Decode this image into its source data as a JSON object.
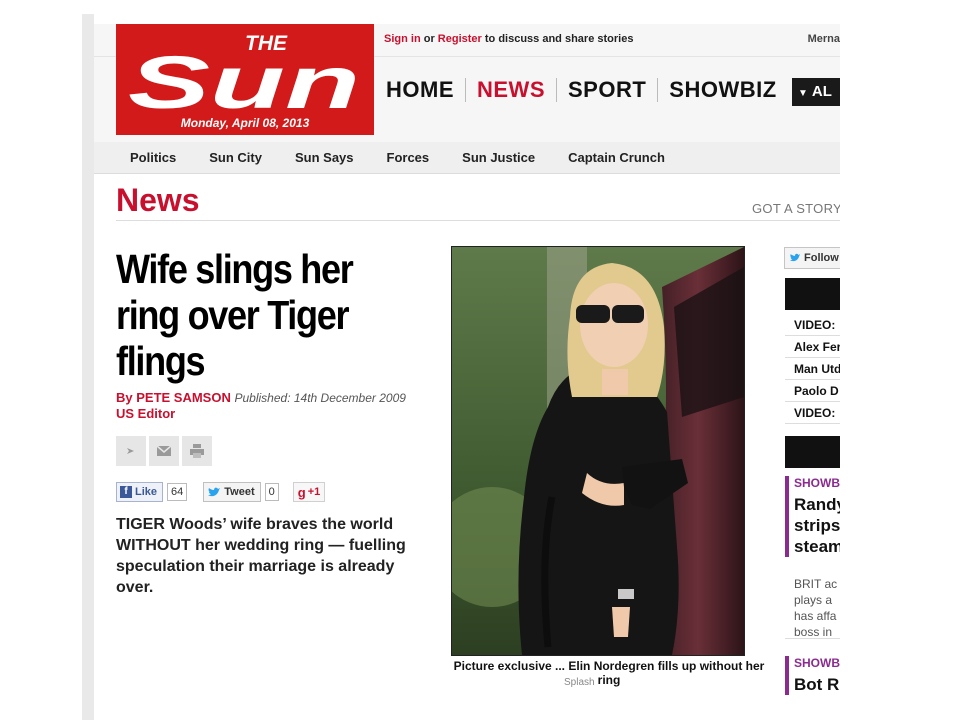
{
  "masthead": {
    "logo_text": "THE Sun",
    "logo_top": "THE",
    "logo_main": "Sun",
    "date": "Monday, April 08, 2013",
    "signin_link": "Sign in",
    "signin_or": " or ",
    "register_link": "Register",
    "signin_rest": " to discuss and share stories",
    "user_name": "Merna"
  },
  "main_nav": {
    "items": [
      {
        "label": "HOME",
        "active": false
      },
      {
        "label": "NEWS",
        "active": true
      },
      {
        "label": "SPORT",
        "active": false
      },
      {
        "label": "SHOWBIZ",
        "active": false
      }
    ],
    "all_button": "AL"
  },
  "sub_nav": {
    "items": [
      "Politics",
      "Sun City",
      "Sun Says",
      "Forces",
      "Sun Justice",
      "Captain Crunch"
    ]
  },
  "section": {
    "title": "News",
    "got_story": "GOT A STORY"
  },
  "article": {
    "headline": "Wife slings her ring over Tiger flings",
    "author": "By PETE SAMSON",
    "published": "Published: 14th December 2009",
    "role": "US Editor",
    "standfirst": "TIGER Woods’ wife braves the world WITHOUT her wedding ring — fuelling speculation their marriage is already over.",
    "photo_caption": "Picture exclusive ... Elin Nordegren fills up without her ring",
    "photo_credit": "Splash"
  },
  "social": {
    "like_label": "Like",
    "like_count": "64",
    "tweet_label": "Tweet",
    "tweet_count": "0",
    "gplus_label": "+1"
  },
  "sidebar": {
    "follow_label": "Follow",
    "most_read": [
      "VIDEO:",
      "Alex Fer",
      "Man Utd",
      "Paolo D",
      "VIDEO:"
    ],
    "promo1": {
      "label": "SHOWB",
      "title_lines": [
        "Randy",
        "strips",
        "steam"
      ],
      "text_lines": [
        "BRIT ac",
        "plays a",
        "has affa",
        "boss in"
      ]
    },
    "promo2": {
      "label": "SHOWB",
      "title_lines": [
        "Bot Ri"
      ]
    }
  },
  "colors": {
    "brand_red": "#d31a1a",
    "link_red": "#c8102e",
    "showbiz_purple": "#8b2a8f"
  }
}
